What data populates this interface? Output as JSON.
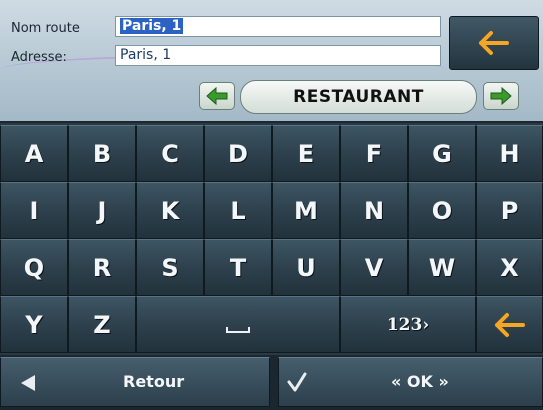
{
  "form": {
    "route_label": "Nom route",
    "route_value": "Paris, 1",
    "address_label": "Adresse:",
    "address_value": "Paris, 1"
  },
  "category": {
    "label": "RESTAURANT",
    "prev_icon": "left-arrow-green-icon",
    "next_icon": "right-arrow-green-icon"
  },
  "keyboard": {
    "row1": [
      "A",
      "B",
      "C",
      "D",
      "E",
      "F",
      "G",
      "H"
    ],
    "row2": [
      "I",
      "J",
      "K",
      "L",
      "M",
      "N",
      "O",
      "P"
    ],
    "row3": [
      "Q",
      "R",
      "S",
      "T",
      "U",
      "V",
      "W",
      "X"
    ],
    "row4": [
      "Y",
      "Z"
    ],
    "numeric_label": "123›",
    "space_icon": "space-bar-icon",
    "backspace_icon": "backspace-arrow-icon"
  },
  "bottom": {
    "back_label": "Retour",
    "ok_label": "« OK »"
  },
  "colors": {
    "accent_arrow": "#f5a623",
    "green_arrow": "#3a9a2e",
    "selection": "#2c62c4"
  }
}
